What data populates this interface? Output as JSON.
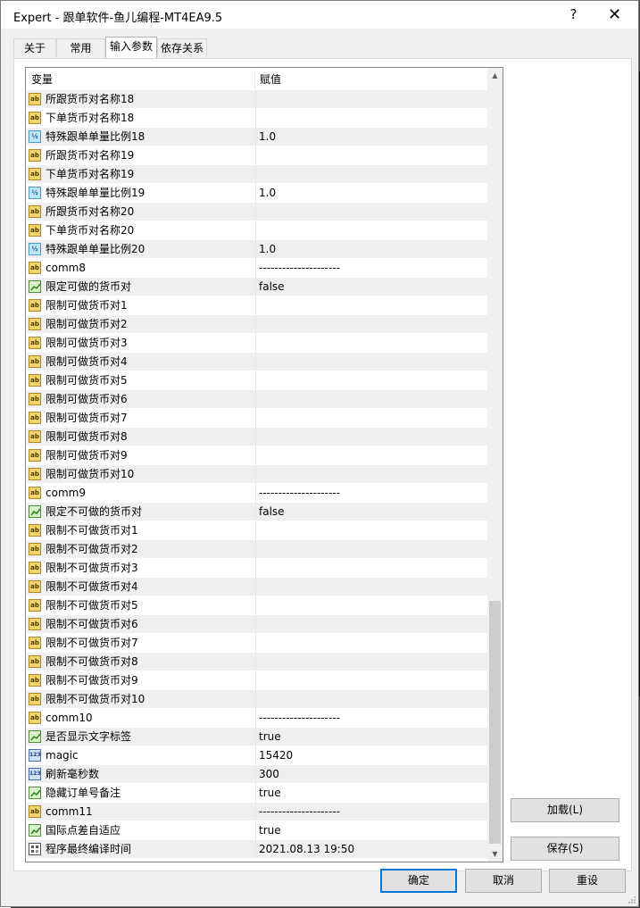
{
  "window": {
    "title": "Expert - 跟单软件-鱼儿编程-MT4EA9.5",
    "help_glyph": "?",
    "close_glyph": "✕"
  },
  "tabs": [
    {
      "label": "关于"
    },
    {
      "label": "常用"
    },
    {
      "label": "输入参数"
    },
    {
      "label": "依存关系"
    }
  ],
  "grid": {
    "col_var": "变量",
    "col_val": "赋值",
    "rows": [
      {
        "icon": "ab",
        "name": "所跟货币对名称18",
        "value": ""
      },
      {
        "icon": "ab",
        "name": "下单货币对名称18",
        "value": ""
      },
      {
        "icon": "half",
        "name": "特殊跟单单量比例18",
        "value": "1.0"
      },
      {
        "icon": "ab",
        "name": "所跟货币对名称19",
        "value": ""
      },
      {
        "icon": "ab",
        "name": "下单货币对名称19",
        "value": ""
      },
      {
        "icon": "half",
        "name": "特殊跟单单量比例19",
        "value": "1.0"
      },
      {
        "icon": "ab",
        "name": "所跟货币对名称20",
        "value": ""
      },
      {
        "icon": "ab",
        "name": "下单货币对名称20",
        "value": ""
      },
      {
        "icon": "half",
        "name": "特殊跟单单量比例20",
        "value": "1.0"
      },
      {
        "icon": "ab",
        "name": "comm8",
        "value": "---------------------"
      },
      {
        "icon": "bool",
        "name": "限定可做的货币对",
        "value": "false"
      },
      {
        "icon": "ab",
        "name": "限制可做货币对1",
        "value": ""
      },
      {
        "icon": "ab",
        "name": "限制可做货币对2",
        "value": ""
      },
      {
        "icon": "ab",
        "name": "限制可做货币对3",
        "value": ""
      },
      {
        "icon": "ab",
        "name": "限制可做货币对4",
        "value": ""
      },
      {
        "icon": "ab",
        "name": "限制可做货币对5",
        "value": ""
      },
      {
        "icon": "ab",
        "name": "限制可做货币对6",
        "value": ""
      },
      {
        "icon": "ab",
        "name": "限制可做货币对7",
        "value": ""
      },
      {
        "icon": "ab",
        "name": "限制可做货币对8",
        "value": ""
      },
      {
        "icon": "ab",
        "name": "限制可做货币对9",
        "value": ""
      },
      {
        "icon": "ab",
        "name": "限制可做货币对10",
        "value": ""
      },
      {
        "icon": "ab",
        "name": "comm9",
        "value": "---------------------"
      },
      {
        "icon": "bool",
        "name": "限定不可做的货币对",
        "value": "false"
      },
      {
        "icon": "ab",
        "name": "限制不可做货币对1",
        "value": ""
      },
      {
        "icon": "ab",
        "name": "限制不可做货币对2",
        "value": ""
      },
      {
        "icon": "ab",
        "name": "限制不可做货币对3",
        "value": ""
      },
      {
        "icon": "ab",
        "name": "限制不可做货币对4",
        "value": ""
      },
      {
        "icon": "ab",
        "name": "限制不可做货币对5",
        "value": ""
      },
      {
        "icon": "ab",
        "name": "限制不可做货币对6",
        "value": ""
      },
      {
        "icon": "ab",
        "name": "限制不可做货币对7",
        "value": ""
      },
      {
        "icon": "ab",
        "name": "限制不可做货币对8",
        "value": ""
      },
      {
        "icon": "ab",
        "name": "限制不可做货币对9",
        "value": ""
      },
      {
        "icon": "ab",
        "name": "限制不可做货币对10",
        "value": ""
      },
      {
        "icon": "ab",
        "name": "comm10",
        "value": "---------------------"
      },
      {
        "icon": "bool",
        "name": "是否显示文字标签",
        "value": "true"
      },
      {
        "icon": "num",
        "name": "magic",
        "value": "15420"
      },
      {
        "icon": "num",
        "name": "刷新毫秒数",
        "value": "300"
      },
      {
        "icon": "bool",
        "name": "隐藏订单号备注",
        "value": "true"
      },
      {
        "icon": "ab",
        "name": "comm11",
        "value": "---------------------"
      },
      {
        "icon": "bool",
        "name": "国际点差自适应",
        "value": "true"
      },
      {
        "icon": "date",
        "name": "程序最终编译时间",
        "value": "2021.08.13 19:50"
      }
    ]
  },
  "buttons": {
    "load": "加载(L)",
    "save": "保存(S)",
    "ok": "确定",
    "cancel": "取消",
    "reset": "重设"
  },
  "scroll": {
    "position_fraction": 1.0
  }
}
